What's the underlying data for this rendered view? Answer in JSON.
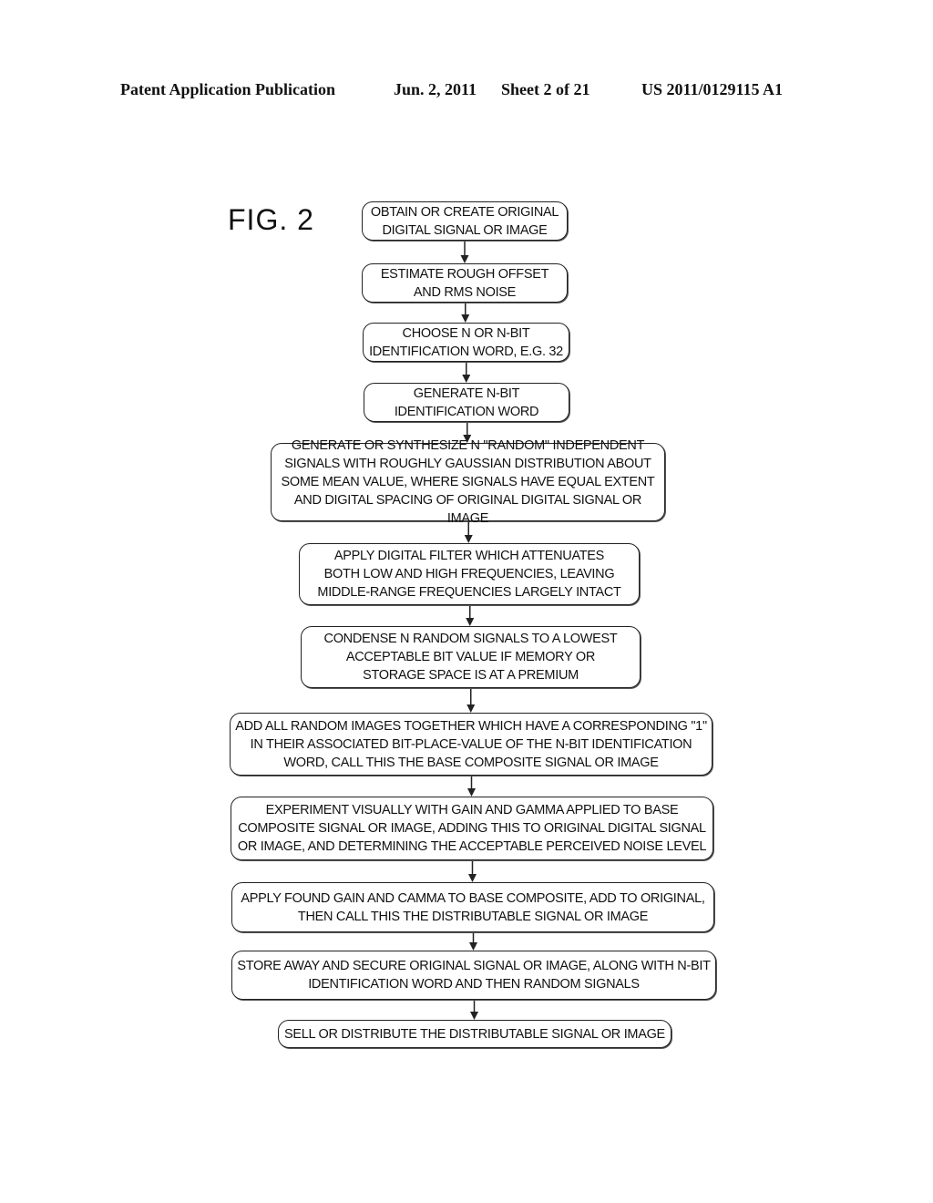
{
  "header": {
    "publication": "Patent Application Publication",
    "date": "Jun. 2, 2011",
    "sheet": "Sheet 2 of 21",
    "patent_number": "US 2011/0129115 A1"
  },
  "figure": {
    "label": "FIG. 2",
    "steps": [
      {
        "lines": [
          "OBTAIN OR CREATE ORIGINAL",
          "DIGITAL SIGNAL OR IMAGE"
        ]
      },
      {
        "lines": [
          "ESTIMATE ROUGH OFFSET",
          "AND RMS NOISE"
        ]
      },
      {
        "lines": [
          "CHOOSE N OR N-BIT",
          "IDENTIFICATION WORD, E.G. 32"
        ]
      },
      {
        "lines": [
          "GENERATE N-BIT",
          "IDENTIFICATION WORD"
        ]
      },
      {
        "lines": [
          "GENERATE OR SYNTHESIZE N \"RANDOM\" INDEPENDENT",
          "SIGNALS WITH ROUGHLY GAUSSIAN DISTRIBUTION ABOUT",
          "SOME MEAN VALUE, WHERE SIGNALS HAVE EQUAL EXTENT",
          "AND DIGITAL SPACING OF ORIGINAL DIGITAL SIGNAL OR IMAGE"
        ]
      },
      {
        "lines": [
          "APPLY DIGITAL FILTER WHICH ATTENUATES",
          "BOTH LOW AND HIGH FREQUENCIES, LEAVING",
          "MIDDLE-RANGE FREQUENCIES LARGELY INTACT"
        ]
      },
      {
        "lines": [
          "CONDENSE N RANDOM SIGNALS TO A LOWEST",
          "ACCEPTABLE BIT VALUE IF MEMORY OR",
          "STORAGE SPACE IS AT A PREMIUM"
        ]
      },
      {
        "lines": [
          "ADD ALL RANDOM IMAGES TOGETHER WHICH HAVE A CORRESPONDING \"1\"",
          "IN THEIR ASSOCIATED BIT-PLACE-VALUE OF THE N-BIT IDENTIFICATION",
          "WORD, CALL THIS THE BASE COMPOSITE SIGNAL OR IMAGE"
        ]
      },
      {
        "lines": [
          "EXPERIMENT VISUALLY WITH GAIN AND GAMMA APPLIED TO BASE",
          "COMPOSITE SIGNAL OR IMAGE, ADDING THIS TO ORIGINAL DIGITAL SIGNAL",
          "OR IMAGE, AND DETERMINING THE ACCEPTABLE PERCEIVED NOISE LEVEL"
        ]
      },
      {
        "lines": [
          "APPLY FOUND GAIN AND CAMMA TO BASE COMPOSITE, ADD TO ORIGINAL,",
          "THEN CALL THIS THE DISTRIBUTABLE SIGNAL OR IMAGE"
        ]
      },
      {
        "lines": [
          "STORE AWAY AND SECURE ORIGINAL SIGNAL OR IMAGE, ALONG WITH N-BIT",
          "IDENTIFICATION WORD AND THEN RANDOM SIGNALS"
        ]
      },
      {
        "lines": [
          "SELL OR DISTRIBUTE THE DISTRIBUTABLE SIGNAL OR IMAGE"
        ]
      }
    ]
  }
}
